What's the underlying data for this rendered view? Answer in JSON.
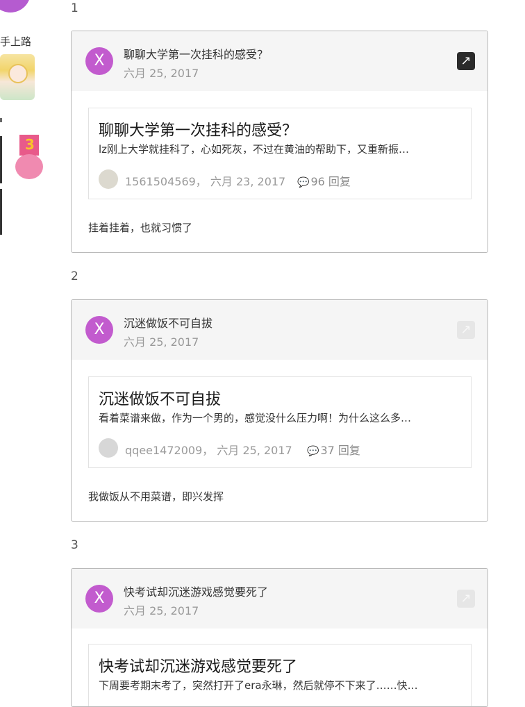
{
  "sidebar": {
    "rank_label": "手上路",
    "medal_number": "3"
  },
  "feed": [
    {
      "index": "1",
      "topic_title": "聊聊大学第一次挂科的感受？",
      "date": "六月 25, 2017",
      "author_initial": "X",
      "quote": {
        "title": "聊聊大学第一次挂科的感受？",
        "excerpt": "lz刚上大学就挂科了，心如死灰，不过在黄油的帮助下，又重新振…",
        "author": "1561504569",
        "date": "六月 23, 2017",
        "replies": "96 回复"
      },
      "comment": "挂着挂着，也就习惯了"
    },
    {
      "index": "2",
      "topic_title": "沉迷做饭不可自拔",
      "date": "六月 25, 2017",
      "author_initial": "X",
      "quote": {
        "title": "沉迷做饭不可自拔",
        "excerpt": "看着菜谱来做，作为一个男的，感觉没什么压力啊！为什么这么多…",
        "author": "qqee1472009",
        "date": "六月 25, 2017",
        "replies": "37 回复"
      },
      "comment": "我做饭从不用菜谱，即兴发挥"
    },
    {
      "index": "3",
      "topic_title": "快考试却沉迷游戏感觉要死了",
      "date": "六月 25, 2017",
      "author_initial": "X",
      "quote": {
        "title": "快考试却沉迷游戏感觉要死了",
        "excerpt": "下周要考期末考了，突然打开了era永琳，然后就停不下来了……快…"
      }
    }
  ],
  "colors": {
    "avatar": "#c25bce",
    "border": "#b9b9b9",
    "header_bg": "#f5f5f5"
  }
}
